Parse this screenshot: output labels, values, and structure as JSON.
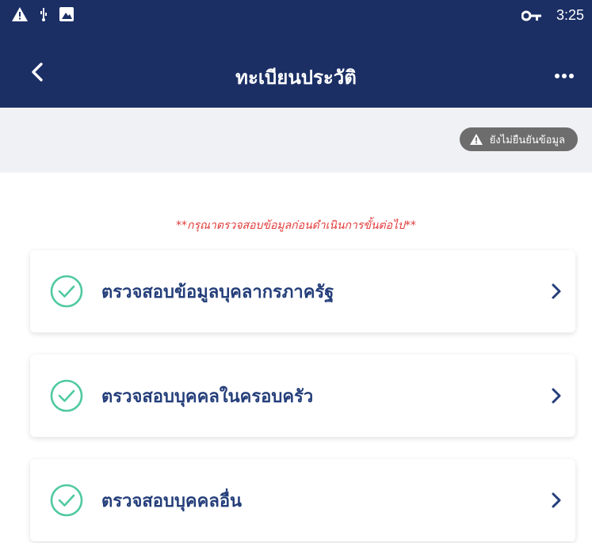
{
  "statusbar": {
    "time": "3:25"
  },
  "header": {
    "title": "ทะเบียนประวัติ"
  },
  "status_badge": {
    "label": "ยังไม่ยืนยันข้อมูล"
  },
  "notice": "**กรุณาตรวจสอบข้อมูลก่อนดำเนินการขั้นต่อไป**",
  "items": [
    {
      "label": "ตรวจสอบข้อมูลบุคลากรภาครัฐ"
    },
    {
      "label": "ตรวจสอบบุคคลในครอบครัว"
    },
    {
      "label": "ตรวจสอบบุคคลอื่น"
    }
  ],
  "colors": {
    "primary": "#1b2f65",
    "check": "#4fc9a1",
    "warning_text": "#e23a3a",
    "badge": "#6d6d6d"
  }
}
